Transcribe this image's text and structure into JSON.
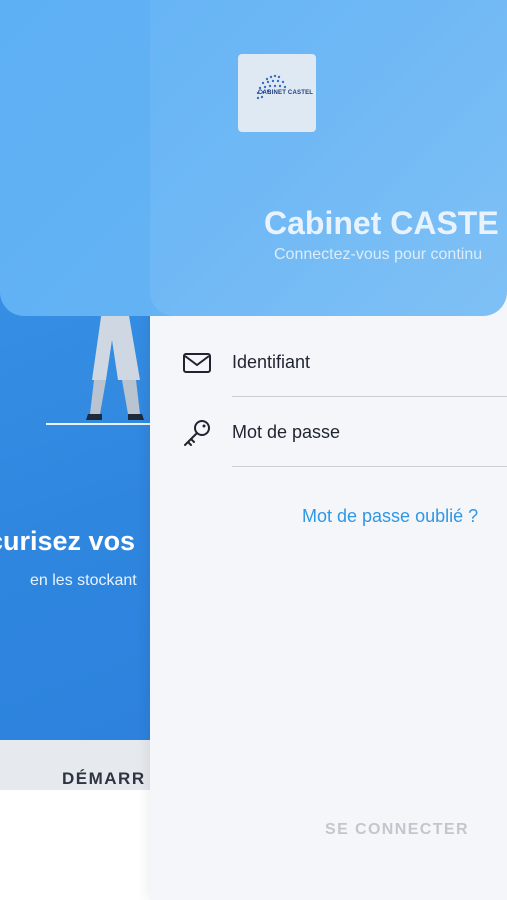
{
  "onboarding": {
    "title": "curisez vos",
    "subtitle": "en les stockant",
    "start_label": "DÉMARR"
  },
  "header": {
    "logo_text": "CABINET CASTEL",
    "title": "Cabinet CASTE",
    "subtitle": "Connectez-vous pour continu"
  },
  "form": {
    "username_placeholder": "Identifiant",
    "password_placeholder": "Mot de passe",
    "forgot_label": "Mot de passe oublié ?",
    "submit_label": "SE CONNECTER"
  },
  "icons": {
    "username": "envelope-icon",
    "password": "key-icon"
  },
  "colors": {
    "header_blue": "#62b2f4",
    "onboard_blue": "#2f86df",
    "link_blue": "#2f97e3",
    "panel_bg": "#f4f6fa",
    "disabled_text": "#c3c7cd"
  }
}
